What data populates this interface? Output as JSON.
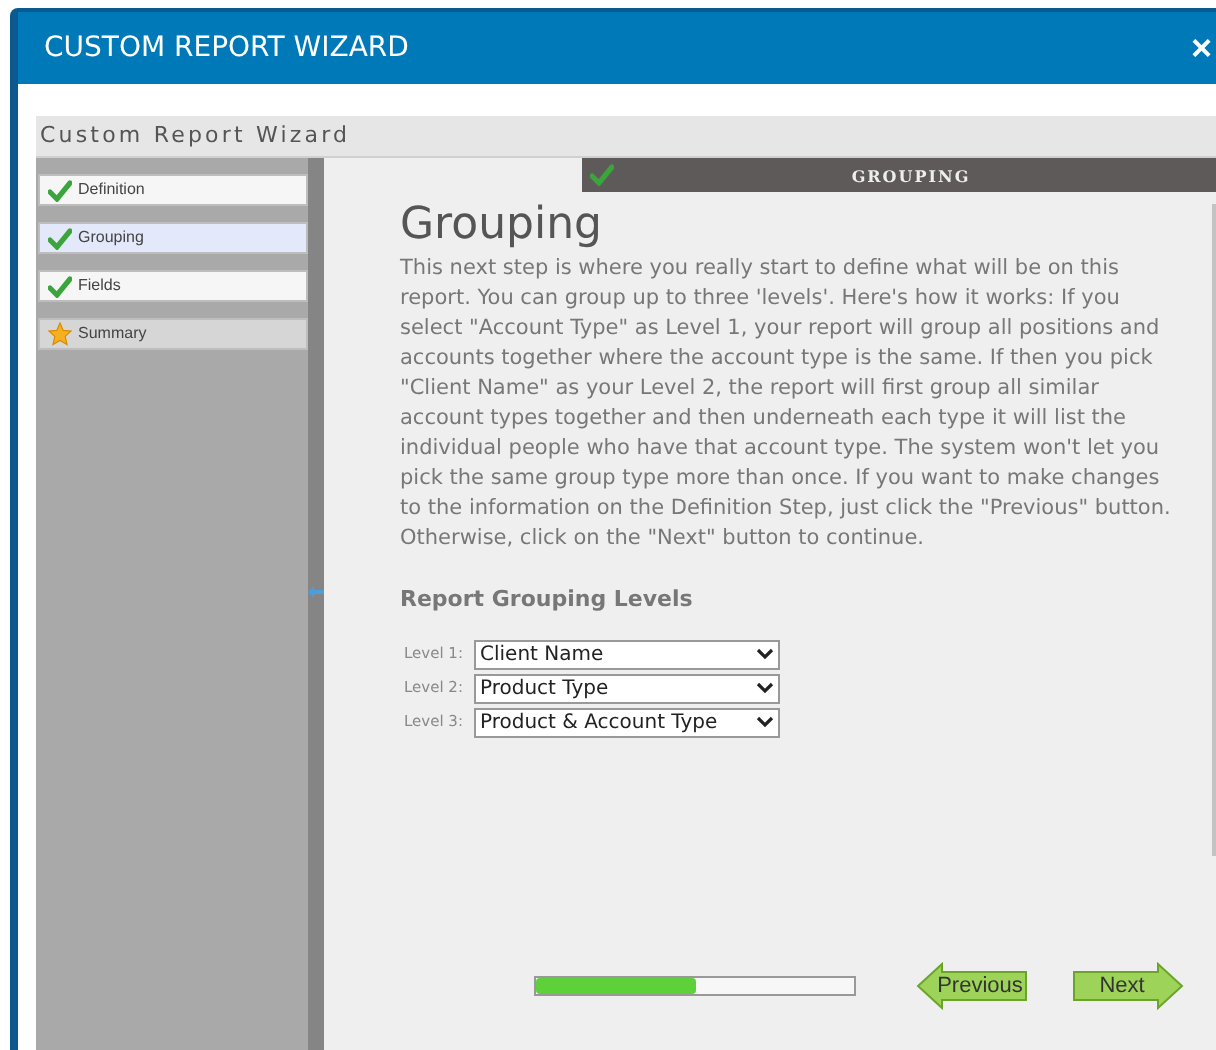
{
  "window": {
    "title": "CUSTOM REPORT WIZARD",
    "close": "×"
  },
  "panel_title": "Custom Report Wizard",
  "steps": [
    {
      "label": "Definition",
      "kind": "done",
      "selected": false
    },
    {
      "label": "Grouping",
      "kind": "done",
      "selected": true
    },
    {
      "label": "Fields",
      "kind": "done",
      "selected": false
    },
    {
      "label": "Summary",
      "kind": "current",
      "selected": false
    }
  ],
  "step_bar": {
    "title": "GROUPING"
  },
  "heading": "Grouping",
  "intro": "This next step is where you really start to define what will be on this report. You can group up to three 'levels'. Here's how it works: If you select \"Account Type\" as Level 1, your report will group all positions and accounts together where the account type is the same. If then you pick \"Client Name\" as your Level 2, the report will first group all similar account types together and then underneath each type it will list the individual people who have that account type. The system won't let you pick the same group type more than once. If you want to make changes to the information on the Definition Step, just click the \"Previous\" button. Otherwise, click on the \"Next\" button to continue.",
  "section_title": "Report Grouping Levels",
  "levels": [
    {
      "label": "Level 1:",
      "value": "Client Name"
    },
    {
      "label": "Level 2:",
      "value": "Product Type"
    },
    {
      "label": "Level 3:",
      "value": "Product & Account Type"
    }
  ],
  "progress": {
    "level": 0.5
  },
  "buttons": {
    "previous": "Previous",
    "next": "Next"
  }
}
